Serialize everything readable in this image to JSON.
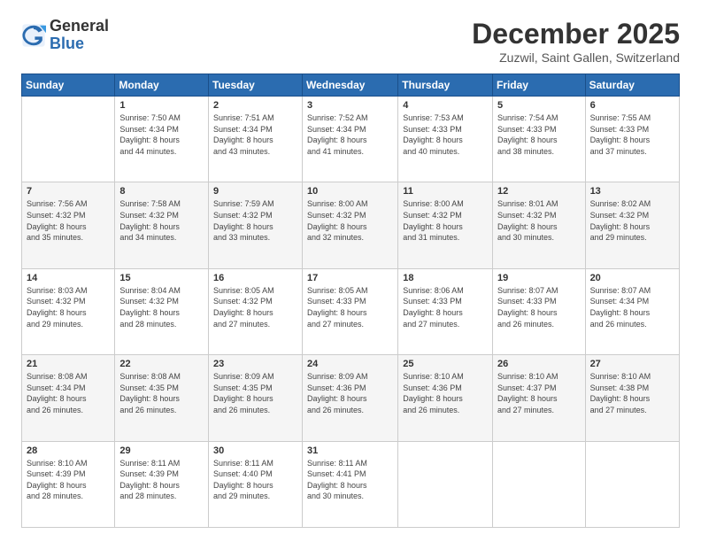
{
  "logo": {
    "general": "General",
    "blue": "Blue"
  },
  "title": "December 2025",
  "location": "Zuzwil, Saint Gallen, Switzerland",
  "days_header": [
    "Sunday",
    "Monday",
    "Tuesday",
    "Wednesday",
    "Thursday",
    "Friday",
    "Saturday"
  ],
  "weeks": [
    [
      {
        "day": "",
        "info": ""
      },
      {
        "day": "1",
        "info": "Sunrise: 7:50 AM\nSunset: 4:34 PM\nDaylight: 8 hours\nand 44 minutes."
      },
      {
        "day": "2",
        "info": "Sunrise: 7:51 AM\nSunset: 4:34 PM\nDaylight: 8 hours\nand 43 minutes."
      },
      {
        "day": "3",
        "info": "Sunrise: 7:52 AM\nSunset: 4:34 PM\nDaylight: 8 hours\nand 41 minutes."
      },
      {
        "day": "4",
        "info": "Sunrise: 7:53 AM\nSunset: 4:33 PM\nDaylight: 8 hours\nand 40 minutes."
      },
      {
        "day": "5",
        "info": "Sunrise: 7:54 AM\nSunset: 4:33 PM\nDaylight: 8 hours\nand 38 minutes."
      },
      {
        "day": "6",
        "info": "Sunrise: 7:55 AM\nSunset: 4:33 PM\nDaylight: 8 hours\nand 37 minutes."
      }
    ],
    [
      {
        "day": "7",
        "info": "Sunrise: 7:56 AM\nSunset: 4:32 PM\nDaylight: 8 hours\nand 35 minutes."
      },
      {
        "day": "8",
        "info": "Sunrise: 7:58 AM\nSunset: 4:32 PM\nDaylight: 8 hours\nand 34 minutes."
      },
      {
        "day": "9",
        "info": "Sunrise: 7:59 AM\nSunset: 4:32 PM\nDaylight: 8 hours\nand 33 minutes."
      },
      {
        "day": "10",
        "info": "Sunrise: 8:00 AM\nSunset: 4:32 PM\nDaylight: 8 hours\nand 32 minutes."
      },
      {
        "day": "11",
        "info": "Sunrise: 8:00 AM\nSunset: 4:32 PM\nDaylight: 8 hours\nand 31 minutes."
      },
      {
        "day": "12",
        "info": "Sunrise: 8:01 AM\nSunset: 4:32 PM\nDaylight: 8 hours\nand 30 minutes."
      },
      {
        "day": "13",
        "info": "Sunrise: 8:02 AM\nSunset: 4:32 PM\nDaylight: 8 hours\nand 29 minutes."
      }
    ],
    [
      {
        "day": "14",
        "info": "Sunrise: 8:03 AM\nSunset: 4:32 PM\nDaylight: 8 hours\nand 29 minutes."
      },
      {
        "day": "15",
        "info": "Sunrise: 8:04 AM\nSunset: 4:32 PM\nDaylight: 8 hours\nand 28 minutes."
      },
      {
        "day": "16",
        "info": "Sunrise: 8:05 AM\nSunset: 4:32 PM\nDaylight: 8 hours\nand 27 minutes."
      },
      {
        "day": "17",
        "info": "Sunrise: 8:05 AM\nSunset: 4:33 PM\nDaylight: 8 hours\nand 27 minutes."
      },
      {
        "day": "18",
        "info": "Sunrise: 8:06 AM\nSunset: 4:33 PM\nDaylight: 8 hours\nand 27 minutes."
      },
      {
        "day": "19",
        "info": "Sunrise: 8:07 AM\nSunset: 4:33 PM\nDaylight: 8 hours\nand 26 minutes."
      },
      {
        "day": "20",
        "info": "Sunrise: 8:07 AM\nSunset: 4:34 PM\nDaylight: 8 hours\nand 26 minutes."
      }
    ],
    [
      {
        "day": "21",
        "info": "Sunrise: 8:08 AM\nSunset: 4:34 PM\nDaylight: 8 hours\nand 26 minutes."
      },
      {
        "day": "22",
        "info": "Sunrise: 8:08 AM\nSunset: 4:35 PM\nDaylight: 8 hours\nand 26 minutes."
      },
      {
        "day": "23",
        "info": "Sunrise: 8:09 AM\nSunset: 4:35 PM\nDaylight: 8 hours\nand 26 minutes."
      },
      {
        "day": "24",
        "info": "Sunrise: 8:09 AM\nSunset: 4:36 PM\nDaylight: 8 hours\nand 26 minutes."
      },
      {
        "day": "25",
        "info": "Sunrise: 8:10 AM\nSunset: 4:36 PM\nDaylight: 8 hours\nand 26 minutes."
      },
      {
        "day": "26",
        "info": "Sunrise: 8:10 AM\nSunset: 4:37 PM\nDaylight: 8 hours\nand 27 minutes."
      },
      {
        "day": "27",
        "info": "Sunrise: 8:10 AM\nSunset: 4:38 PM\nDaylight: 8 hours\nand 27 minutes."
      }
    ],
    [
      {
        "day": "28",
        "info": "Sunrise: 8:10 AM\nSunset: 4:39 PM\nDaylight: 8 hours\nand 28 minutes."
      },
      {
        "day": "29",
        "info": "Sunrise: 8:11 AM\nSunset: 4:39 PM\nDaylight: 8 hours\nand 28 minutes."
      },
      {
        "day": "30",
        "info": "Sunrise: 8:11 AM\nSunset: 4:40 PM\nDaylight: 8 hours\nand 29 minutes."
      },
      {
        "day": "31",
        "info": "Sunrise: 8:11 AM\nSunset: 4:41 PM\nDaylight: 8 hours\nand 30 minutes."
      },
      {
        "day": "",
        "info": ""
      },
      {
        "day": "",
        "info": ""
      },
      {
        "day": "",
        "info": ""
      }
    ]
  ]
}
